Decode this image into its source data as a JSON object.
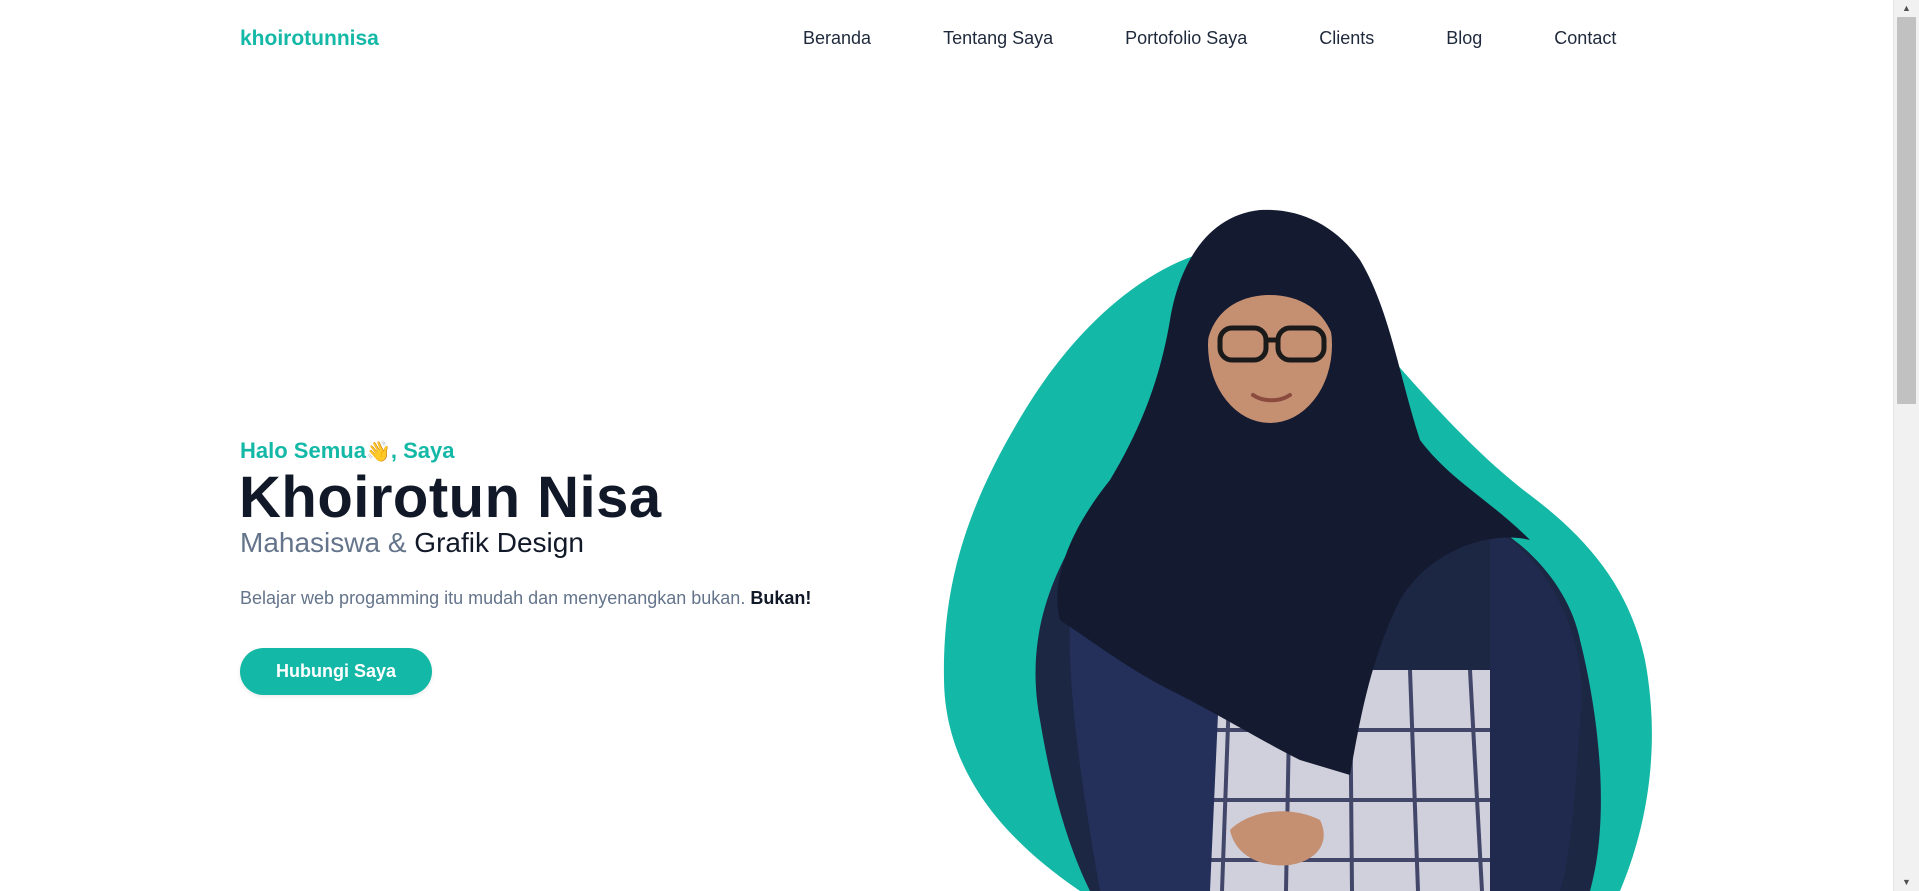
{
  "header": {
    "brand": "khoirotunnisa",
    "nav": [
      "Beranda",
      "Tentang Saya",
      "Portofolio Saya",
      "Clients",
      "Blog",
      "Contact"
    ]
  },
  "hero": {
    "greeting": "Halo Semua",
    "greeting_emoji": "👋",
    "greeting_suffix": ", Saya",
    "name": "Khoirotun Nisa",
    "role_prefix": "Mahasiswa & ",
    "role_strong": "Grafik Design",
    "tagline": "Belajar web progamming itu mudah dan menyenangkan bukan.",
    "tagline_strong": "Bukan!",
    "cta_label": "Hubungi Saya"
  },
  "colors": {
    "accent": "#14b8a6",
    "heading": "#111827",
    "muted": "#64748b"
  },
  "icons": {
    "wave": "waving-hand-icon",
    "scroll_up": "scroll-up-arrow-icon",
    "scroll_down": "scroll-down-arrow-icon"
  }
}
